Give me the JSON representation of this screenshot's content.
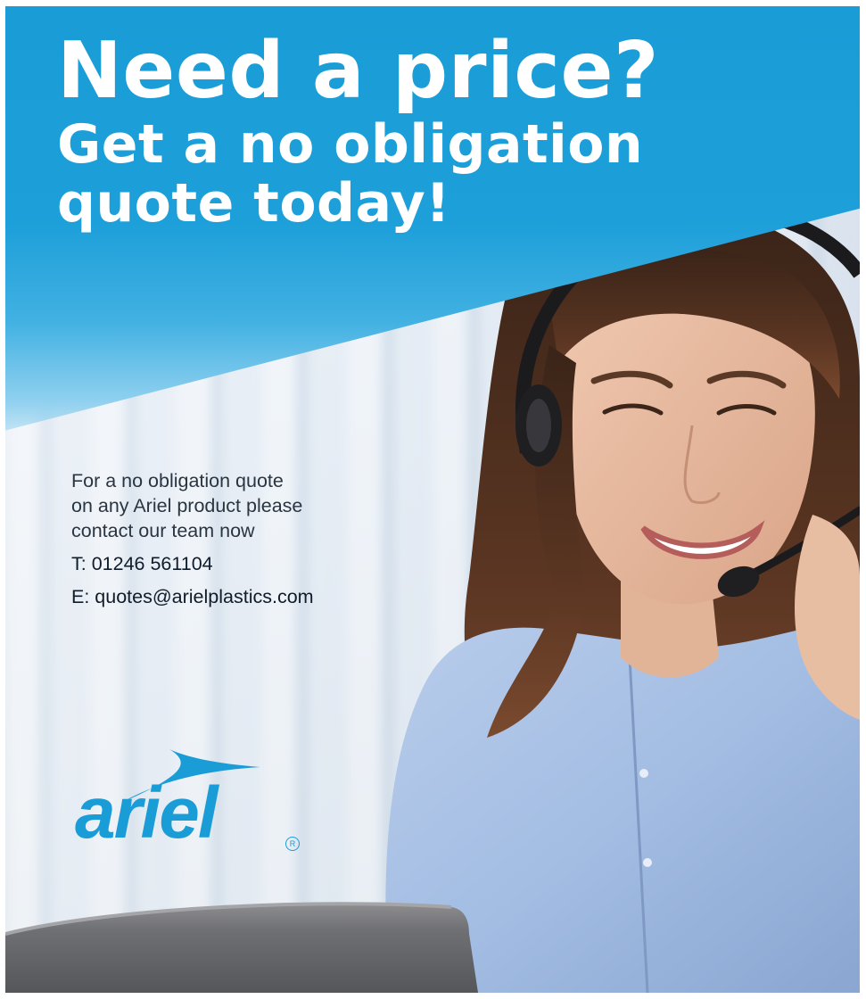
{
  "headline": {
    "line1": "Need a price?",
    "line2": "Get a no obligation",
    "line3": "quote today!"
  },
  "intro": {
    "line1": "For a no obligation quote",
    "line2": "on any Ariel product please",
    "line3": "contact our team now"
  },
  "contact": {
    "phone": "T: 01246 561104",
    "email": "E: quotes@arielplastics.com"
  },
  "brand": {
    "name": "ariel",
    "registered_mark": "R"
  },
  "colors": {
    "brand_blue": "#1a9cd7",
    "headline_text": "#ffffff",
    "body_text": "#2a3542"
  },
  "icons": [
    "ariel-logo-swoosh-icon",
    "registered-trademark-icon"
  ]
}
